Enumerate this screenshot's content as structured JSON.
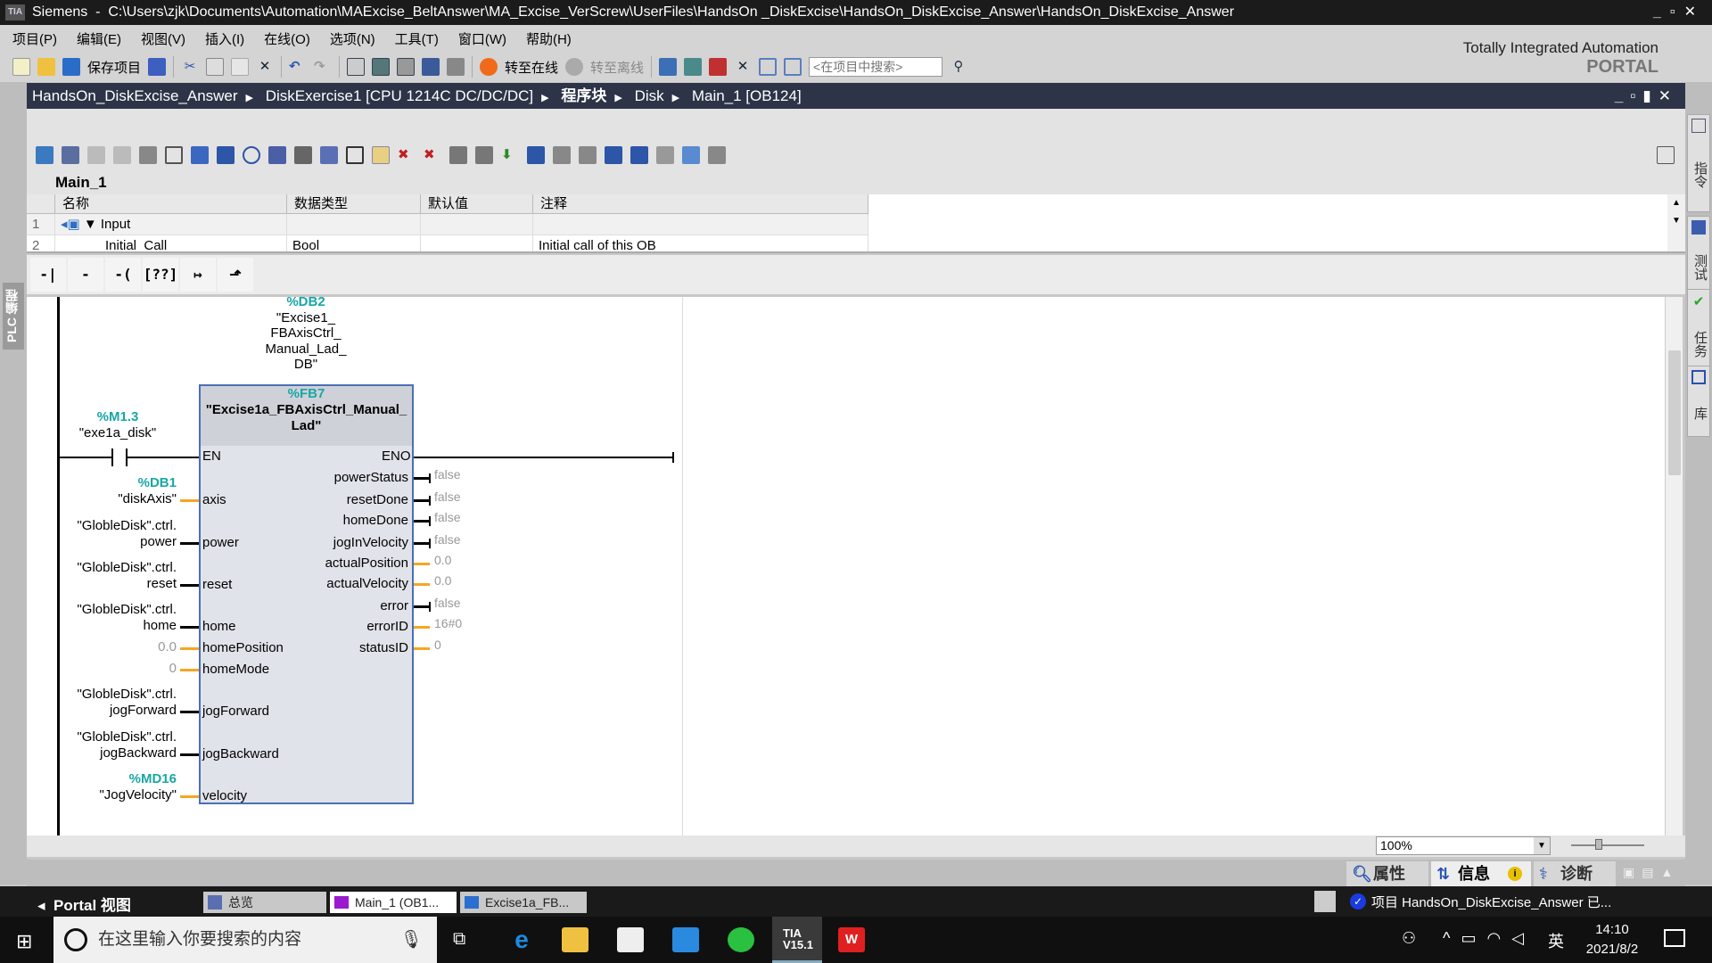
{
  "titlebar": {
    "app": "Siemens",
    "path": "C:\\Users\\zjk\\Documents\\Automation\\MAExcise_BeltAnswer\\MA_Excise_VerScrew\\UserFiles\\HandsOn _DiskExcise\\HandsOn_DiskExcise_Answer\\HandsOn_DiskExcise_Answer",
    "logo": "TIA"
  },
  "menu": [
    "项目(P)",
    "编辑(E)",
    "视图(V)",
    "插入(I)",
    "在线(O)",
    "选项(N)",
    "工具(T)",
    "窗口(W)",
    "帮助(H)"
  ],
  "toolbar": {
    "save": "保存项目",
    "go_online": "转至在线",
    "go_offline": "转至离线",
    "search_placeholder": "<在项目中搜索>"
  },
  "brand": {
    "line1": "Totally Integrated Automation",
    "line2": "PORTAL"
  },
  "breadcrumb": [
    "HandsOn_DiskExcise_Answer",
    "DiskExercise1 [CPU 1214C DC/DC/DC]",
    "程序块",
    "Disk",
    "Main_1 [OB124]"
  ],
  "left_tab": "PLC 编程",
  "right_tabs": [
    "指令",
    "测试",
    "任务",
    "库"
  ],
  "block_name": "Main_1",
  "interface": {
    "columns": [
      "名称",
      "数据类型",
      "默认值",
      "注释"
    ],
    "rows": [
      {
        "num": "1",
        "name": "Input",
        "type": "",
        "default": "",
        "comment": ""
      },
      {
        "num": "2",
        "name": "Initial_Call",
        "type": "Bool",
        "default": "",
        "comment": "Initial call of this OB"
      }
    ]
  },
  "instructions": [
    "-| |-",
    "-|/|-",
    "-( )-",
    "[??]",
    "↦",
    "⬏"
  ],
  "network": {
    "instance_db": {
      "addr": "%DB2",
      "name": [
        "\"Excise1_",
        "FBAxisCtrl_",
        "Manual_Lad_",
        "DB\""
      ]
    },
    "fb": {
      "addr": "%FB7",
      "name": [
        "\"Excise1a_FBAxisCtrl_Manual_",
        "Lad\""
      ],
      "en": "EN",
      "eno": "ENO"
    },
    "contact": {
      "addr": "%M1.3",
      "name": "\"exe1a_disk\""
    },
    "inputs": [
      {
        "pin": "axis",
        "addr": "%DB1",
        "operand": [
          "\"diskAxis\""
        ],
        "wire": "#f5a623"
      },
      {
        "pin": "power",
        "operand": [
          "\"GlobleDisk\".ctrl.",
          "power"
        ],
        "wire": "#000000"
      },
      {
        "pin": "reset",
        "operand": [
          "\"GlobleDisk\".ctrl.",
          "reset"
        ],
        "wire": "#000000"
      },
      {
        "pin": "home",
        "operand": [
          "\"GlobleDisk\".ctrl.",
          "home"
        ],
        "wire": "#000000"
      },
      {
        "pin": "homePosition",
        "operand": [
          "0.0"
        ],
        "constant": true,
        "wire": "#f5a623"
      },
      {
        "pin": "homeMode",
        "operand": [
          "0"
        ],
        "constant": true,
        "wire": "#f5a623"
      },
      {
        "pin": "jogForward",
        "operand": [
          "\"GlobleDisk\".ctrl.",
          "jogForward"
        ],
        "wire": "#000000"
      },
      {
        "pin": "jogBackward",
        "operand": [
          "\"GlobleDisk\".ctrl.",
          "jogBackward"
        ],
        "wire": "#000000"
      },
      {
        "pin": "velocity",
        "addr": "%MD16",
        "operand": [
          "\"JogVelocity\""
        ],
        "wire": "#f5a623"
      }
    ],
    "outputs": [
      {
        "pin": "powerStatus",
        "value": "false",
        "wire": "#000000"
      },
      {
        "pin": "resetDone",
        "value": "false",
        "wire": "#000000"
      },
      {
        "pin": "homeDone",
        "value": "false",
        "wire": "#000000"
      },
      {
        "pin": "jogInVelocity",
        "value": "false",
        "wire": "#000000"
      },
      {
        "pin": "actualPosition",
        "value": "0.0",
        "wire": "#f5a623"
      },
      {
        "pin": "actualVelocity",
        "value": "0.0",
        "wire": "#f5a623"
      },
      {
        "pin": "error",
        "value": "false",
        "wire": "#000000"
      },
      {
        "pin": "errorID",
        "value": "16#0",
        "wire": "#f5a623"
      },
      {
        "pin": "statusID",
        "value": "0",
        "wire": "#f5a623"
      }
    ]
  },
  "zoom": "100%",
  "inspector_tabs": [
    "属性",
    "信息",
    "诊断"
  ],
  "portal": {
    "back": "Portal 视图",
    "tabs": [
      "总览",
      "Main_1 (OB1...",
      "Excise1a_FB..."
    ],
    "status": "项目 HandsOn_DiskExcise_Answer 已..."
  },
  "taskbar": {
    "search": "在这里输入你要搜索的内容",
    "time": "14:10",
    "date": "2021/8/2",
    "ime": "英",
    "tia_label": "TIA V15.1"
  },
  "colors": {
    "accent_teal": "#1aa6a6",
    "value_wire": "#f5a623",
    "breadcrumb_bg": "#2d3447",
    "fb_border": "#4a6fb5"
  }
}
